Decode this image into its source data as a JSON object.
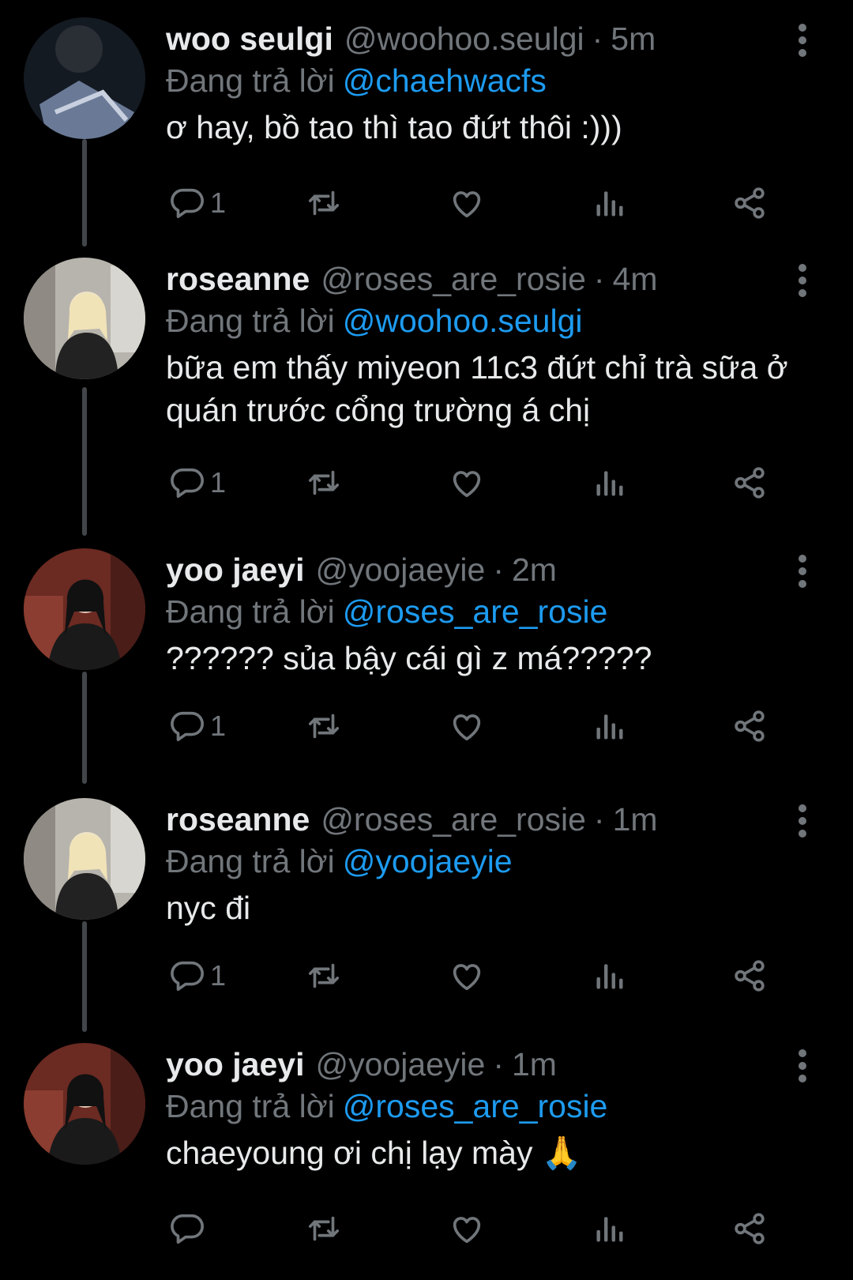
{
  "labels": {
    "replying_prefix": "Đang trả lời"
  },
  "colors": {
    "background": "#000000",
    "text": "#e7e9ea",
    "muted": "#71767b",
    "mention": "#1d9bf0",
    "thread_line": "#42464a"
  },
  "icons": {
    "reply": "reply-icon",
    "retweet": "retweet-icon",
    "like": "heart-icon",
    "views": "analytics-icon",
    "share": "share-icon",
    "more": "more-vertical-icon"
  },
  "tweets": [
    {
      "display_name": "woo seulgi",
      "handle": "@woohoo.seulgi",
      "time": "5m",
      "replying_to": "@chaehwacfs",
      "text": "ơ hay, bồ tao thì tao đứt thôi :)))",
      "reply_count": "1"
    },
    {
      "display_name": "roseanne",
      "handle": "@roses_are_rosie",
      "time": "4m",
      "replying_to": "@woohoo.seulgi",
      "text": "bữa em thấy miyeon 11c3 đứt chỉ trà sữa ở quán trước cổng trường á chị",
      "reply_count": "1"
    },
    {
      "display_name": "yoo jaeyi",
      "handle": "@yoojaeyie",
      "time": "2m",
      "replying_to": "@roses_are_rosie",
      "text": "?????? sủa bậy cái gì z má?????",
      "reply_count": "1"
    },
    {
      "display_name": "roseanne",
      "handle": "@roses_are_rosie",
      "time": "1m",
      "replying_to": "@yoojaeyie",
      "text": "nyc đi",
      "reply_count": "1"
    },
    {
      "display_name": "yoo jaeyi",
      "handle": "@yoojaeyie",
      "time": "1m",
      "replying_to": "@roses_are_rosie",
      "text": "chaeyoung ơi chị lạy mày 🙏",
      "reply_count": ""
    }
  ]
}
